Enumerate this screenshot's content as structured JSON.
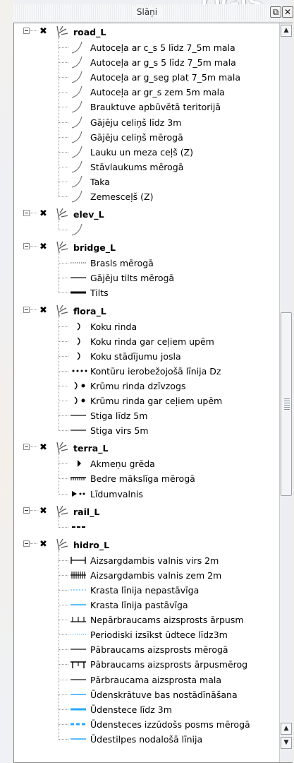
{
  "panel": {
    "title": "Slāņi",
    "brand": "QGIS",
    "float_icon": "float-icon",
    "close_icon": "close-icon"
  },
  "scroll": {
    "position_fraction": 0.55
  },
  "groups": [
    {
      "name": "road_L",
      "items": [
        {
          "label": "Autoceļa ar c_s 5 līdz 7_5m mala",
          "symbol": "curve"
        },
        {
          "label": "Autoceļa ar g_s 5 līdz 7_5m mala",
          "symbol": "curve"
        },
        {
          "label": "Autoceļa ar g_seg plat 7_5m mala",
          "symbol": "curve"
        },
        {
          "label": "Autoceļa ar gr_s zem 5m mala",
          "symbol": "curve"
        },
        {
          "label": "Brauktuve apbūvētā teritorijā",
          "symbol": "curve"
        },
        {
          "label": "Gājēju celiņš līdz 3m",
          "symbol": "curve"
        },
        {
          "label": "Gājēju celiņš mērogā",
          "symbol": "curve"
        },
        {
          "label": "Lauku un meza ceļš (Z)",
          "symbol": "curve"
        },
        {
          "label": "Stāvlaukums mērogā",
          "symbol": "curve"
        },
        {
          "label": "Taka",
          "symbol": "curve"
        },
        {
          "label": "Zemesceļš (Z)",
          "symbol": "curve"
        }
      ]
    },
    {
      "name": "elev_L",
      "items": [
        {
          "label": "",
          "symbol": "curve"
        }
      ]
    },
    {
      "name": "bridge_L",
      "items": [
        {
          "label": "Brasls mērogā",
          "symbol": "dotted-line"
        },
        {
          "label": "Gājēju tilts mērogā",
          "symbol": "thin-line"
        },
        {
          "label": "Tilts",
          "symbol": "thick-line"
        }
      ]
    },
    {
      "name": "flora_L",
      "items": [
        {
          "label": "Koku rinda",
          "symbol": "bracket"
        },
        {
          "label": "Koku rinda gar ceļiem upēm",
          "symbol": "bracket"
        },
        {
          "label": "Koku stādījumu josla",
          "symbol": "bracket"
        },
        {
          "label": "Kontūru ierobežojošā līnija Dz",
          "symbol": "dots"
        },
        {
          "label": "Krūmu rinda dzīvzogs",
          "symbol": "bracket-dot"
        },
        {
          "label": "Krūmu rinda gar ceļiem upēm",
          "symbol": "bracket-dot"
        },
        {
          "label": "Stiga līdz 5m",
          "symbol": "thin-line"
        },
        {
          "label": "Stiga virs 5m",
          "symbol": "thin-line"
        }
      ]
    },
    {
      "name": "terra_L",
      "items": [
        {
          "label": "Akmeņu grēda",
          "symbol": "triangle"
        },
        {
          "label": "Bedre mākslīga mērogā",
          "symbol": "comb"
        },
        {
          "label": "Līdumvalnis",
          "symbol": "arrow-dots"
        }
      ]
    },
    {
      "name": "rail_L",
      "items": [
        {
          "label": "",
          "symbol": "rail"
        }
      ]
    },
    {
      "name": "hidro_L",
      "items": [
        {
          "label": "Aizsargdambis valnis virs 2m",
          "symbol": "bar-ends"
        },
        {
          "label": "Aizsargdambis valnis zem 2m",
          "symbol": "hatched"
        },
        {
          "label": "Krasta līnija nepastāvīga",
          "symbol": "blue-dashed"
        },
        {
          "label": "Krasta līnija pastāvīga",
          "symbol": "blue-thin"
        },
        {
          "label": "Nepārbraucams aizsprosts ārpusm",
          "symbol": "ticks-up"
        },
        {
          "label": "Periodiski izsīkst ūdtece līdz3m",
          "symbol": "blue-dotted"
        },
        {
          "label": "Pābraucams aizsprosts mērogā",
          "symbol": "thin-line"
        },
        {
          "label": "Pābraucams aizsprosts ārpusmērog",
          "symbol": "gate"
        },
        {
          "label": "Pārbraucama aizsprosta mala",
          "symbol": "thin-line"
        },
        {
          "label": "Ūdenskrātuve bas nostādīnāšana",
          "symbol": "blue-thin"
        },
        {
          "label": "Ūdenstece līdz 3m",
          "symbol": "blue-thick"
        },
        {
          "label": "Ūdensteces izzūdošs posms mērogā",
          "symbol": "blue-dash-thick"
        },
        {
          "label": "Ūdestilpes nodalošā līnija",
          "symbol": "blue-thin"
        }
      ]
    }
  ]
}
